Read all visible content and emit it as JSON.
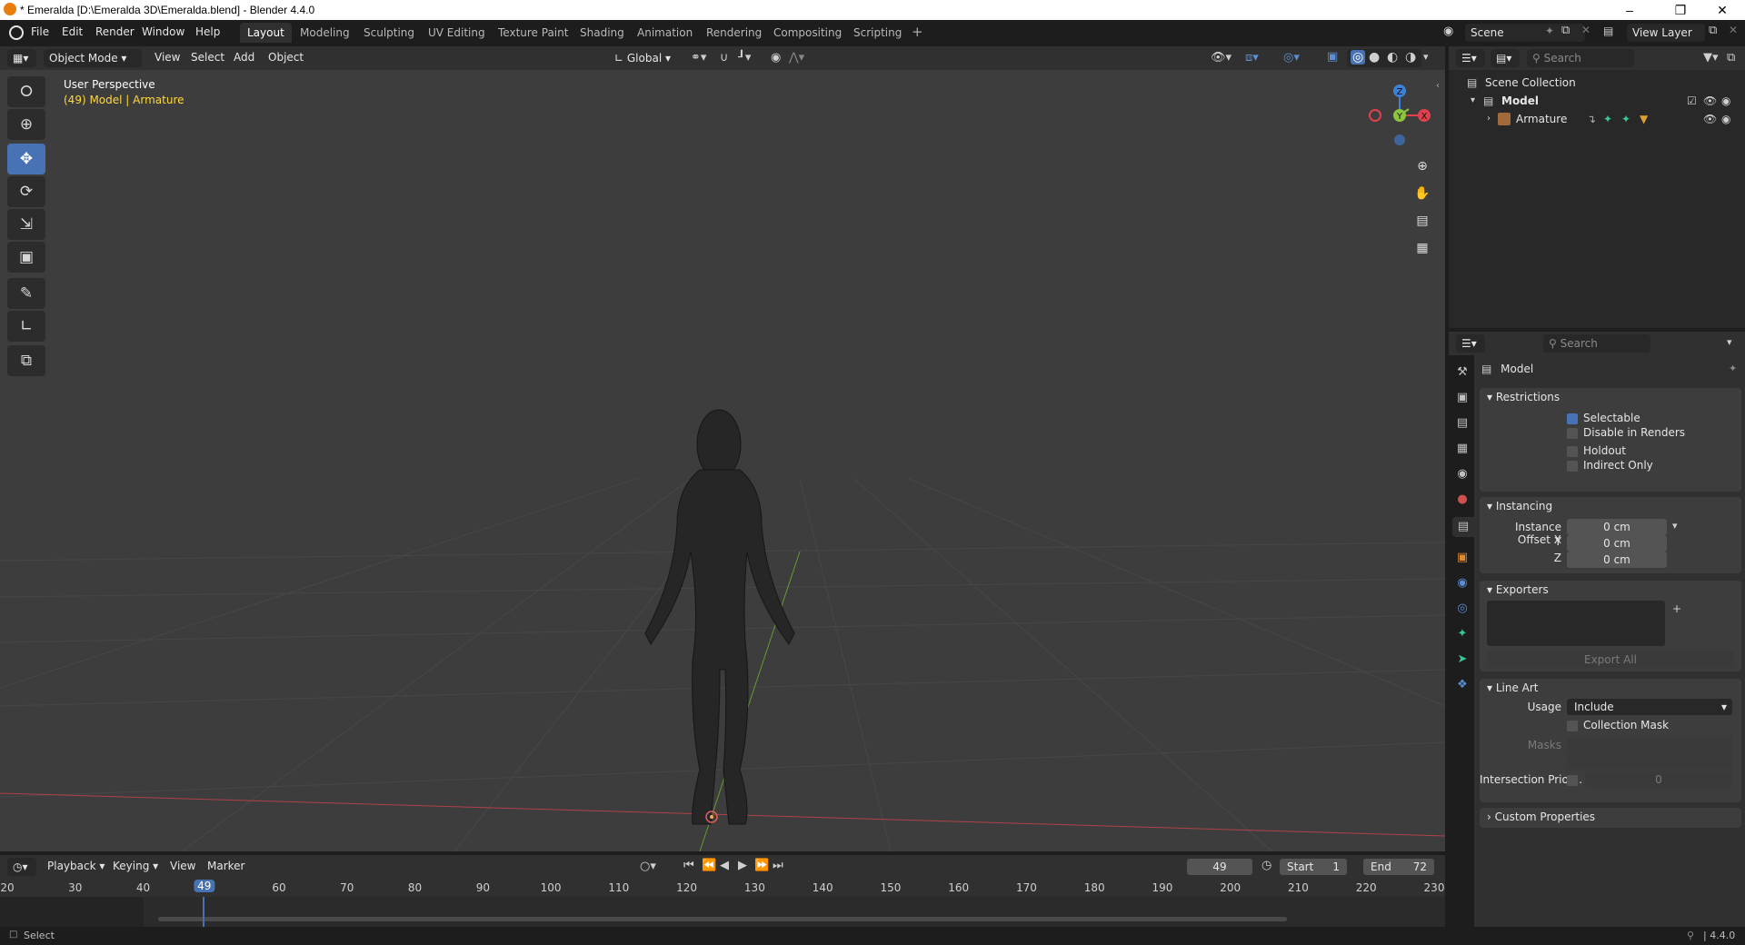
{
  "window": {
    "title": "* Emeralda [D:\\Emeralda 3D\\Emeralda.blend] - Blender 4.4.0"
  },
  "menus": [
    "File",
    "Edit",
    "Render",
    "Window",
    "Help"
  ],
  "workspaces": [
    "Layout",
    "Modeling",
    "Sculpting",
    "UV Editing",
    "Texture Paint",
    "Shading",
    "Animation",
    "Rendering",
    "Compositing",
    "Scripting"
  ],
  "scene": {
    "name": "Scene",
    "view_layer": "View Layer"
  },
  "viewport_header": {
    "mode": "Object Mode",
    "menus": [
      "View",
      "Select",
      "Add",
      "Object"
    ],
    "transform_orientation": "Global"
  },
  "viewport": {
    "perspective": "User Perspective",
    "context_frame": "(49) Model",
    "context_object": "Armature",
    "gizmo": {
      "x": "X",
      "y": "Y",
      "z": "Z"
    }
  },
  "outliner": {
    "search_placeholder": "Search",
    "root": "Scene Collection",
    "collection": "Model",
    "object": "Armature"
  },
  "properties": {
    "search_placeholder": "Search",
    "context_name": "Model",
    "restrictions": {
      "title": "Restrictions",
      "selectable": {
        "label": "Selectable",
        "checked": true
      },
      "disable_renders": {
        "label": "Disable in Renders",
        "checked": false
      },
      "holdout": {
        "label": "Holdout",
        "checked": false
      },
      "indirect_only": {
        "label": "Indirect Only",
        "checked": false
      }
    },
    "instancing": {
      "title": "Instancing",
      "offset_x_label": "Instance Offset X",
      "offset_y_label": "Y",
      "offset_z_label": "Z",
      "offset_x": "0 cm",
      "offset_y": "0 cm",
      "offset_z": "0 cm"
    },
    "exporters": {
      "title": "Exporters",
      "export_all": "Export All"
    },
    "line_art": {
      "title": "Line Art",
      "usage_label": "Usage",
      "usage_value": "Include",
      "collection_mask": "Collection Mask",
      "masks_label": "Masks",
      "intersection_label": "Intersection Prior...",
      "intersection_value": "0"
    },
    "custom_properties": {
      "title": "Custom Properties"
    }
  },
  "timeline": {
    "menus": [
      "Playback",
      "Keying",
      "View",
      "Marker"
    ],
    "current_frame": "49",
    "start_label": "Start",
    "start": "1",
    "end_label": "End",
    "end": "72",
    "ticks": [
      "20",
      "30",
      "40",
      "49",
      "60",
      "70",
      "80",
      "90",
      "100",
      "110",
      "120",
      "130",
      "140",
      "150",
      "160",
      "170",
      "180",
      "190",
      "200",
      "210",
      "220",
      "230"
    ]
  },
  "status": {
    "left": "Select",
    "version": "4.4.0"
  },
  "colors": {
    "accent": "#4772b3",
    "viewport_bg": "#3d3d3d",
    "context_yellow": "#ffd83d",
    "x_axis": "#e0414d",
    "y_axis": "#8ac53a",
    "z_axis": "#3d80d8"
  }
}
